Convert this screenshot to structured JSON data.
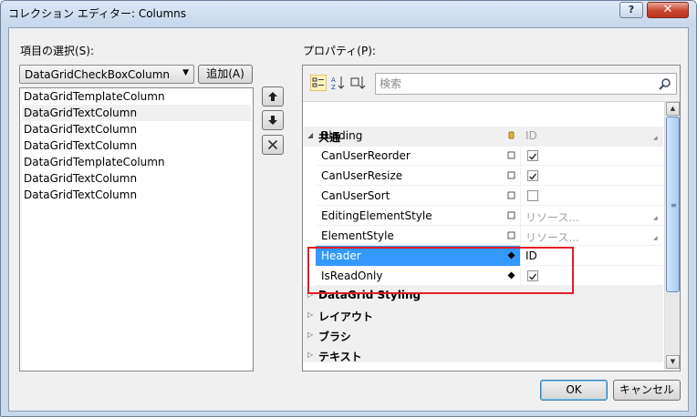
{
  "window": {
    "title": "コレクション エディター: Columns",
    "help_label": "?",
    "close_label": "✕"
  },
  "items": {
    "label": "項目の選択(S):",
    "combo_value": "DataGridCheckBoxColumn",
    "add_label": "追加(A)",
    "list": [
      "DataGridTemplateColumn",
      "DataGridTextColumn",
      "DataGridTextColumn",
      "DataGridTextColumn",
      "DataGridTemplateColumn",
      "DataGridTextColumn",
      "DataGridTextColumn"
    ],
    "selected_index": 1
  },
  "properties": {
    "label": "プロパティ(P):",
    "search_placeholder": "検索",
    "category_common": "共通",
    "rows": [
      {
        "name": "Binding",
        "value": "ID",
        "marker": "binding-icon",
        "dropdown": true
      },
      {
        "name": "CanUserReorder",
        "checked": true
      },
      {
        "name": "CanUserResize",
        "checked": true
      },
      {
        "name": "CanUserSort",
        "checked": false
      },
      {
        "name": "EditingElementStyle",
        "value": "リソース...",
        "dropdown": true
      },
      {
        "name": "ElementStyle",
        "value": "リソース...",
        "dropdown": true
      },
      {
        "name": "Header",
        "value": "ID",
        "marker": "diamond-icon",
        "selected": true
      },
      {
        "name": "IsReadOnly",
        "checked": true,
        "marker": "diamond-icon"
      }
    ],
    "categories": [
      "DataGrid Styling",
      "レイアウト",
      "ブラシ",
      "テキスト"
    ]
  },
  "buttons": {
    "ok": "OK",
    "cancel": "キャンセル"
  },
  "colors": {
    "selection": "#3399ff",
    "highlight_box": "#e21c23",
    "titlebar": "#c6d7ec"
  }
}
